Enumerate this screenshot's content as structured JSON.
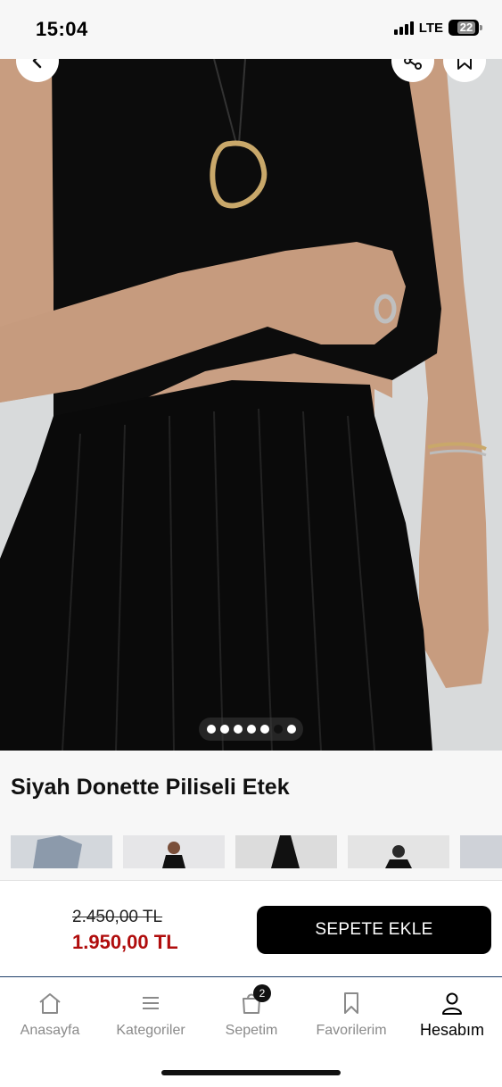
{
  "status_bar": {
    "time": "15:04",
    "network": "LTE",
    "battery": "22"
  },
  "hero": {
    "back_icon": "chevron-left-icon",
    "share_icon": "share-icon",
    "bookmark_icon": "bookmark-icon",
    "image_subject": "model-wearing-black-top-and-pleated-skirt",
    "carousel": {
      "total": 7,
      "active_index": 5
    }
  },
  "product": {
    "title": "Siyah Donette Piliseli Etek"
  },
  "thumbnails": [
    {
      "icon": "product-thumbnail"
    },
    {
      "icon": "product-thumbnail"
    },
    {
      "icon": "product-thumbnail"
    },
    {
      "icon": "product-thumbnail"
    },
    {
      "icon": "product-thumbnail"
    }
  ],
  "price": {
    "old": "2.450,00 TL",
    "new": "1.950,00 TL",
    "new_color": "#b00d0d",
    "add_to_cart_label": "SEPETE EKLE"
  },
  "tab_bar": {
    "items": [
      {
        "label": "Anasayfa",
        "icon": "home-icon"
      },
      {
        "label": "Kategoriler",
        "icon": "menu-icon"
      },
      {
        "label": "Sepetim",
        "icon": "bag-icon",
        "badge": "2"
      },
      {
        "label": "Favorilerim",
        "icon": "bookmark-icon"
      },
      {
        "label": "Hesabım",
        "icon": "user-icon",
        "active": true
      }
    ]
  }
}
